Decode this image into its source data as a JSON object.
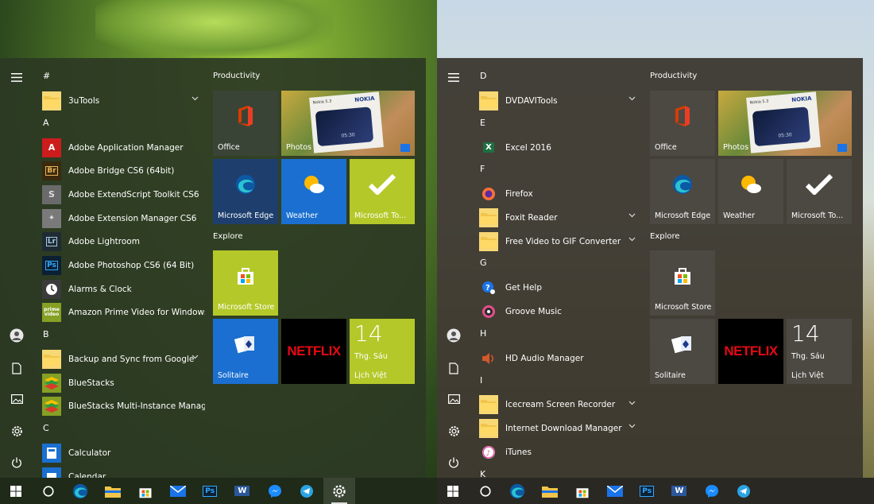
{
  "colors": {
    "left_accent": "#b4c829",
    "left_blue": "#1a6fd0",
    "right_tile": "#4c4943",
    "netflix_red": "#e50914",
    "office_red": "#d83b01"
  },
  "left": {
    "rail_icons": [
      "hamburger-icon",
      "user-icon",
      "document-icon",
      "pictures-icon",
      "settings-icon",
      "power-icon"
    ],
    "apps": [
      {
        "kind": "letter",
        "text": "#"
      },
      {
        "kind": "app",
        "label": "3uTools",
        "icon": "folder-icon",
        "chevron": true
      },
      {
        "kind": "letter",
        "text": "A"
      },
      {
        "kind": "app",
        "label": "Adobe Application Manager",
        "icon": "adobe-icon"
      },
      {
        "kind": "app",
        "label": "Adobe Bridge CS6 (64bit)",
        "icon": "bridge-icon"
      },
      {
        "kind": "app",
        "label": "Adobe ExtendScript Toolkit CS6",
        "icon": "extendscript-icon"
      },
      {
        "kind": "app",
        "label": "Adobe Extension Manager CS6",
        "icon": "extension-manager-icon"
      },
      {
        "kind": "app",
        "label": "Adobe Lightroom",
        "icon": "lightroom-icon"
      },
      {
        "kind": "app",
        "label": "Adobe Photoshop CS6 (64 Bit)",
        "icon": "photoshop-icon"
      },
      {
        "kind": "app",
        "label": "Alarms & Clock",
        "icon": "clock-icon"
      },
      {
        "kind": "app",
        "label": "Amazon Prime Video for Windows",
        "icon": "prime-video-icon"
      },
      {
        "kind": "letter",
        "text": "B"
      },
      {
        "kind": "app",
        "label": "Backup and Sync from Google",
        "icon": "folder-icon",
        "chevron": true
      },
      {
        "kind": "app",
        "label": "BlueStacks",
        "icon": "bluestacks-icon"
      },
      {
        "kind": "app",
        "label": "BlueStacks Multi-Instance Manager",
        "icon": "bluestacks-multi-icon"
      },
      {
        "kind": "letter",
        "text": "C"
      },
      {
        "kind": "app",
        "label": "Calculator",
        "icon": "calculator-icon"
      },
      {
        "kind": "app",
        "label": "Calendar",
        "icon": "calendar-icon"
      }
    ],
    "groups": {
      "productivity": "Productivity",
      "explore": "Explore"
    },
    "tiles": {
      "office": "Office",
      "photos": "Photos",
      "edge": "Microsoft Edge",
      "weather": "Weather",
      "todo": "Microsoft To...",
      "store": "Microsoft Store",
      "solitaire": "Solitaire",
      "calendar_day": "14",
      "calendar_weekday": "Thg. Sáu",
      "calendar_app": "Lịch Việt"
    },
    "taskbar": [
      "windows-start-icon",
      "cortana-circle-icon",
      "edge-icon",
      "file-explorer-icon",
      "store-icon",
      "mail-icon",
      "photoshop-icon",
      "word-icon",
      "messenger-icon",
      "telegram-icon",
      "settings-icon"
    ]
  },
  "right": {
    "rail_icons": [
      "hamburger-icon",
      "user-icon",
      "document-icon",
      "pictures-icon",
      "settings-icon",
      "power-icon"
    ],
    "apps": [
      {
        "kind": "letter",
        "text": "D"
      },
      {
        "kind": "app",
        "label": "DVDAVITools",
        "icon": "folder-icon",
        "chevron": true
      },
      {
        "kind": "letter",
        "text": "E"
      },
      {
        "kind": "app",
        "label": "Excel 2016",
        "icon": "excel-icon"
      },
      {
        "kind": "letter",
        "text": "F"
      },
      {
        "kind": "app",
        "label": "Firefox",
        "icon": "firefox-icon"
      },
      {
        "kind": "app",
        "label": "Foxit Reader",
        "icon": "folder-icon",
        "chevron": true
      },
      {
        "kind": "app",
        "label": "Free Video to GIF Converter",
        "icon": "folder-icon",
        "chevron": true
      },
      {
        "kind": "letter",
        "text": "G"
      },
      {
        "kind": "app",
        "label": "Get Help",
        "icon": "help-icon"
      },
      {
        "kind": "app",
        "label": "Groove Music",
        "icon": "groove-music-icon"
      },
      {
        "kind": "letter",
        "text": "H"
      },
      {
        "kind": "app",
        "label": "HD Audio Manager",
        "icon": "speaker-icon"
      },
      {
        "kind": "letter",
        "text": "I"
      },
      {
        "kind": "app",
        "label": "Icecream Screen Recorder",
        "icon": "folder-icon",
        "chevron": true
      },
      {
        "kind": "app",
        "label": "Internet Download Manager",
        "icon": "folder-icon",
        "chevron": true
      },
      {
        "kind": "app",
        "label": "iTunes",
        "icon": "itunes-icon"
      },
      {
        "kind": "letter",
        "text": "K"
      }
    ],
    "groups": {
      "productivity": "Productivity",
      "explore": "Explore"
    },
    "tiles": {
      "office": "Office",
      "photos": "Photos",
      "edge": "Microsoft Edge",
      "weather": "Weather",
      "todo": "Microsoft To...",
      "store": "Microsoft Store",
      "solitaire": "Solitaire",
      "calendar_day": "14",
      "calendar_weekday": "Thg. Sáu",
      "calendar_app": "Lịch Việt"
    },
    "taskbar": [
      "windows-start-icon",
      "cortana-circle-icon",
      "edge-icon",
      "file-explorer-icon",
      "store-icon",
      "mail-icon",
      "photoshop-icon",
      "word-icon",
      "messenger-icon",
      "telegram-icon"
    ]
  },
  "photo_tile": {
    "brand": "NOKIA",
    "model": "Nokia 5.3",
    "clock": "05:30"
  }
}
